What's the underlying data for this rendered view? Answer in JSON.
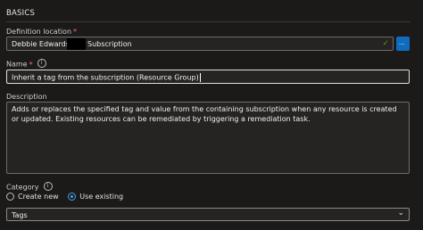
{
  "section": {
    "title": "BASICS"
  },
  "definition_location": {
    "label": "Definition location",
    "required_marker": "*",
    "value_name": "Debbie Edwards",
    "value_suffix": "Subscription",
    "valid_icon": "check-icon",
    "browse_button": "..."
  },
  "name": {
    "label": "Name",
    "required_marker": "*",
    "info_icon": "i",
    "value": "Inherit a tag from the subscription (Resource Group)"
  },
  "description": {
    "label": "Description",
    "value": "Adds or replaces the specified tag and value from the containing subscription when any resource is created or updated. Existing resources can be remediated by triggering a remediation task."
  },
  "category": {
    "label": "Category",
    "info_icon": "i",
    "options": [
      {
        "label": "Create new",
        "selected": false
      },
      {
        "label": "Use existing",
        "selected": true
      }
    ],
    "selected_value": "Tags"
  }
}
